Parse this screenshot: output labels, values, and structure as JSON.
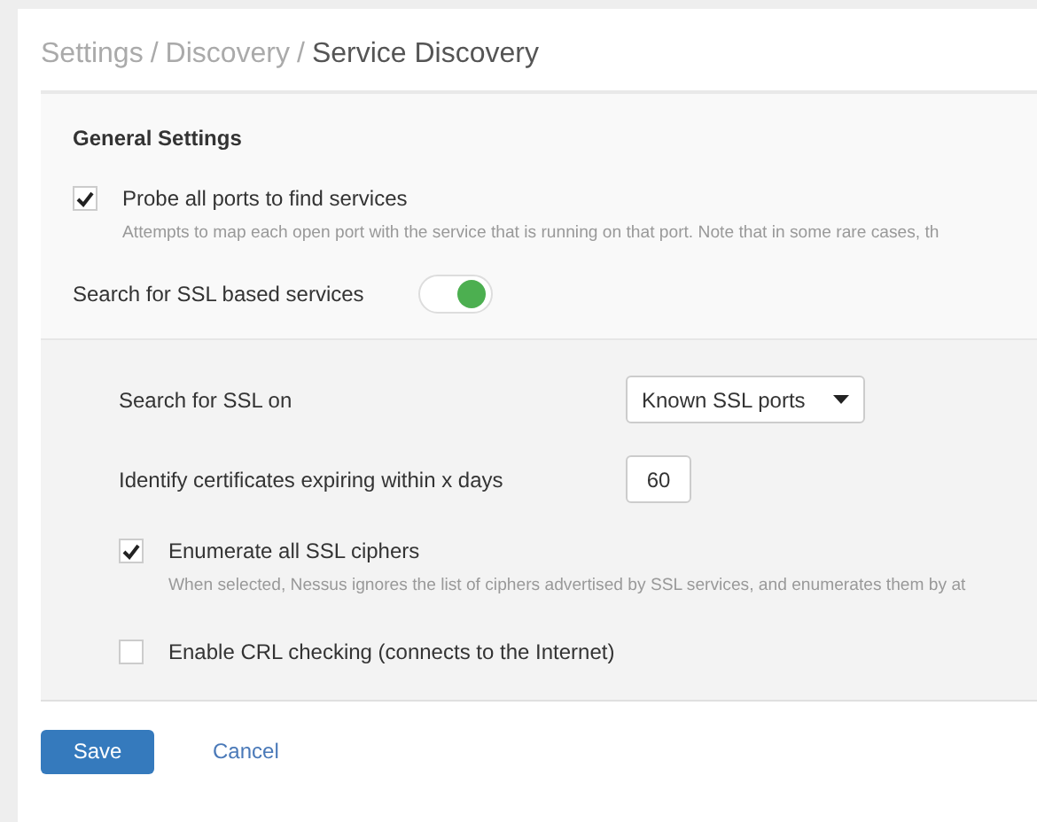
{
  "breadcrumb": {
    "separator": "/",
    "items": [
      {
        "label": "Settings",
        "current": false
      },
      {
        "label": "Discovery",
        "current": false
      },
      {
        "label": "Service Discovery",
        "current": true
      }
    ]
  },
  "general": {
    "heading": "General Settings",
    "probe": {
      "label": "Probe all ports to find services",
      "checked": true,
      "description": "Attempts to map each open port with the service that is running on that port. Note that in some rare cases, th"
    },
    "ssl_toggle": {
      "label": "Search for SSL based services",
      "on": true
    }
  },
  "ssl": [
    {
      "kind": "select",
      "label": "Search for SSL on",
      "value": "Known SSL ports"
    },
    {
      "kind": "number",
      "label": "Identify certificates expiring within x days",
      "value": "60"
    },
    {
      "kind": "checkbox",
      "label": "Enumerate all SSL ciphers",
      "checked": true,
      "description": "When selected, Nessus ignores the list of ciphers advertised by SSL services, and enumerates them by at"
    },
    {
      "kind": "checkbox",
      "label": "Enable CRL checking (connects to the Internet)",
      "checked": false
    }
  ],
  "buttons": {
    "save": "Save",
    "cancel": "Cancel"
  }
}
